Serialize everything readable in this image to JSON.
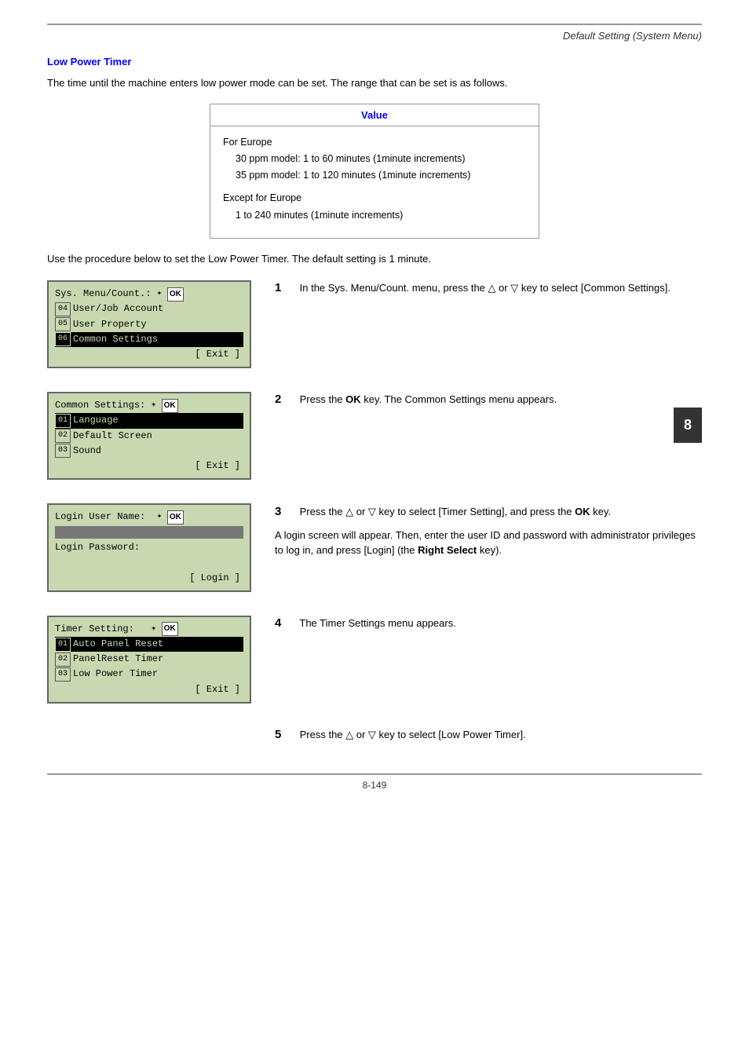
{
  "header": {
    "title": "Default Setting (System Menu)",
    "rule": true
  },
  "section": {
    "title": "Low Power Timer",
    "intro": "The time until the machine enters low power mode can be set. The range that can be set is as follows.",
    "table": {
      "header": "Value",
      "rows": [
        {
          "label": "For Europe",
          "details": [
            "30 ppm model: 1 to 60 minutes (1minute increments)",
            "35 ppm model: 1 to 120 minutes (1minute increments)"
          ]
        },
        {
          "label": "Except for Europe",
          "details": [
            "1 to 240 minutes (1minute increments)"
          ]
        }
      ]
    },
    "procedure_intro": "Use the procedure below to set the Low Power Timer. The default setting is 1 minute.",
    "steps": [
      {
        "number": "1",
        "lcd": {
          "line1": "Sys. Menu/Count.:",
          "line1_icons": "✦ OK",
          "rows": [
            {
              "num": "04",
              "text": "User/Job Account",
              "highlight": false
            },
            {
              "num": "05",
              "text": "User Property",
              "highlight": false
            },
            {
              "num": "06",
              "text": "Common Settings",
              "highlight": true
            }
          ],
          "exit": "[ Exit ]"
        },
        "text": "In the Sys. Menu/Count. menu, press the △ or ▽ key to select [Common Settings]."
      },
      {
        "number": "2",
        "lcd": {
          "line1": "Common Settings:",
          "line1_icons": "✦ OK",
          "rows": [
            {
              "num": "01",
              "text": "Language",
              "highlight": true
            },
            {
              "num": "02",
              "text": "Default Screen",
              "highlight": false
            },
            {
              "num": "03",
              "text": "Sound",
              "highlight": false
            }
          ],
          "exit": "[ Exit ]"
        },
        "text": "Press the OK key. The Common Settings menu appears."
      },
      {
        "number": "3",
        "lcd": {
          "line1": "Login User Name:",
          "line1_icons": "✦ OK",
          "line2": "",
          "line3": "Login Password:",
          "exit": "[ Login ]"
        },
        "text": "Press the △ or ▽ key to select [Timer Setting], and press the OK key.",
        "subtext": "A login screen will appear. Then, enter the user ID and password with administrator privileges to log in, and press [Login] (the Right Select key)."
      },
      {
        "number": "4",
        "lcd": {
          "line1": "Timer Setting:",
          "line1_icons": "✦ OK",
          "rows": [
            {
              "num": "01",
              "text": "Auto Panel Reset",
              "highlight": true
            },
            {
              "num": "02",
              "text": "PanelReset Timer",
              "highlight": false
            },
            {
              "num": "03",
              "text": "Low Power Timer",
              "highlight": false
            }
          ],
          "exit": "[ Exit ]"
        },
        "text": "The Timer Settings menu appears."
      },
      {
        "number": "5",
        "text": "Press the △ or ▽ key to select [Low Power Timer]."
      }
    ]
  },
  "footer": {
    "page": "8-149"
  },
  "badge": "8"
}
